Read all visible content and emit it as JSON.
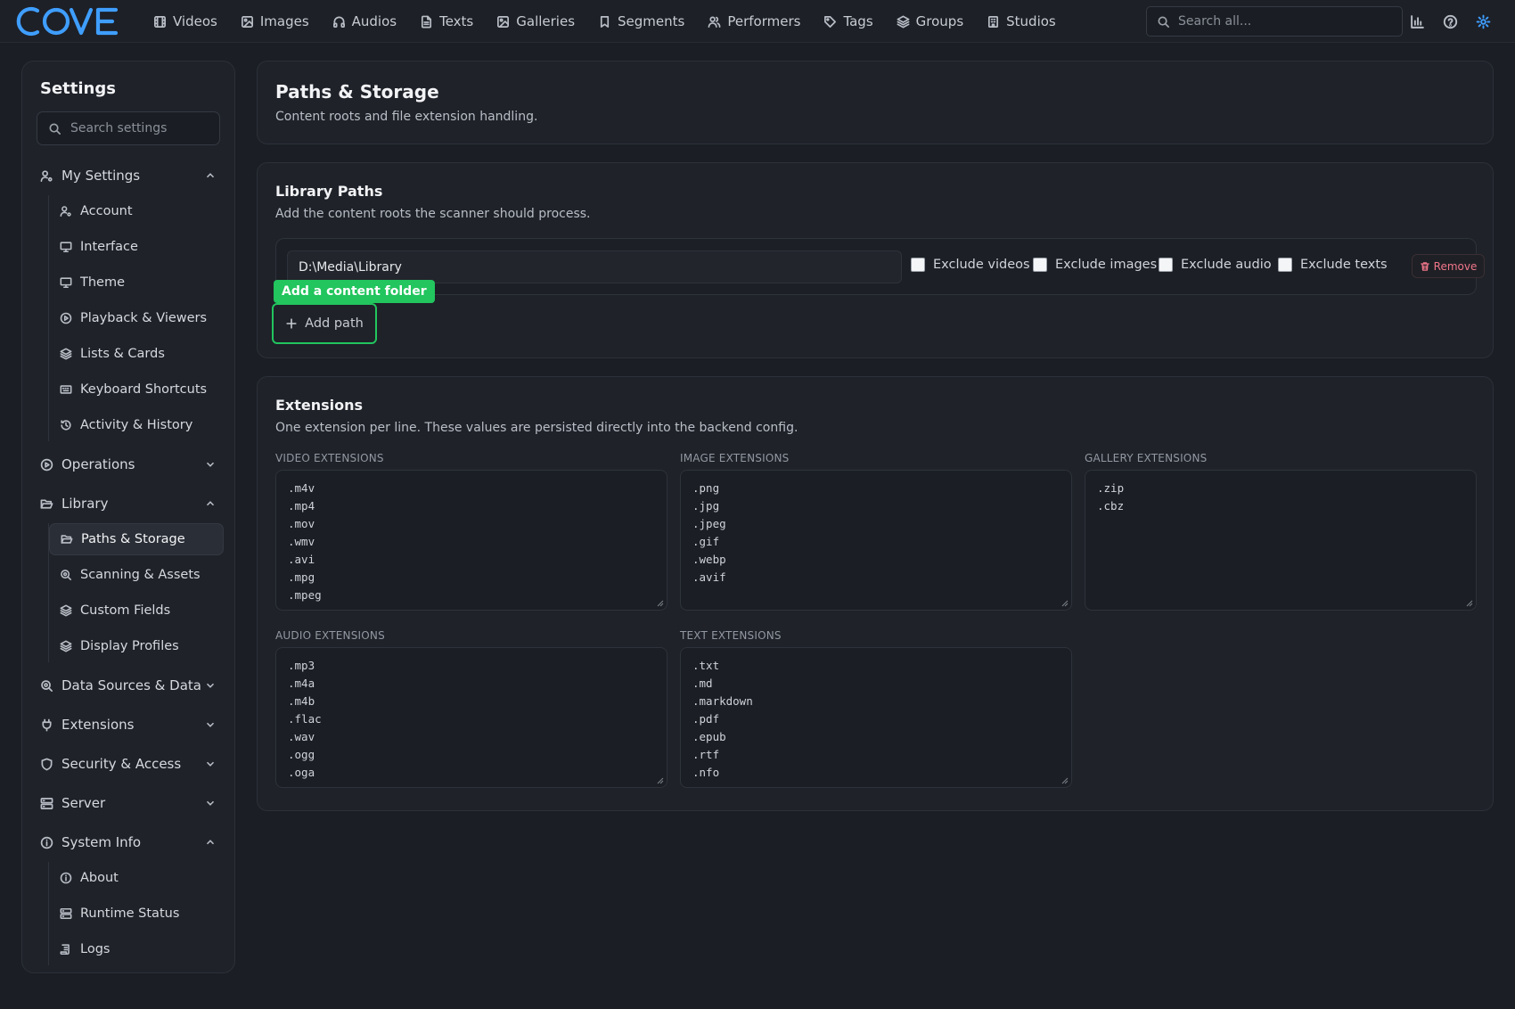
{
  "app": {
    "logo_text": "COVE"
  },
  "nav": [
    {
      "label": "Videos",
      "icon": "film-icon"
    },
    {
      "label": "Images",
      "icon": "image-icon"
    },
    {
      "label": "Audios",
      "icon": "headphones-icon"
    },
    {
      "label": "Texts",
      "icon": "file-text-icon"
    },
    {
      "label": "Galleries",
      "icon": "gallery-icon"
    },
    {
      "label": "Segments",
      "icon": "bookmark-icon"
    },
    {
      "label": "Performers",
      "icon": "users-icon"
    },
    {
      "label": "Tags",
      "icon": "tag-icon"
    },
    {
      "label": "Groups",
      "icon": "layers-icon"
    },
    {
      "label": "Studios",
      "icon": "building-icon"
    }
  ],
  "search": {
    "placeholder": "Search all..."
  },
  "sidebar": {
    "title": "Settings",
    "search_placeholder": "Search settings",
    "my_settings": "My Settings",
    "my_items": [
      "Account",
      "Interface",
      "Theme",
      "Playback & Viewers",
      "Lists & Cards",
      "Keyboard Shortcuts",
      "Activity & History"
    ],
    "operations": "Operations",
    "library": "Library",
    "library_items": [
      "Paths & Storage",
      "Scanning & Assets",
      "Custom Fields",
      "Display Profiles"
    ],
    "data_sources": "Data Sources & Data",
    "extensions": "Extensions",
    "security": "Security & Access",
    "server": "Server",
    "system_info": "System Info",
    "system_items": [
      "About",
      "Runtime Status",
      "Logs"
    ]
  },
  "header": {
    "title": "Paths & Storage",
    "subtitle": "Content roots and file extension handling."
  },
  "library_paths": {
    "title": "Library Paths",
    "subtitle": "Add the content roots the scanner should process.",
    "path_value": "D:\\Media\\Library",
    "exclude_videos": "Exclude videos",
    "exclude_images": "Exclude images",
    "exclude_audio": "Exclude audio",
    "exclude_texts": "Exclude texts",
    "remove_label": "Remove",
    "tooltip": "Add a content folder",
    "add_label": "Add path"
  },
  "extensions": {
    "title": "Extensions",
    "subtitle": "One extension per line. These values are persisted directly into the backend config.",
    "video_label": "VIDEO EXTENSIONS",
    "video": [
      ".m4v",
      ".mp4",
      ".mov",
      ".wmv",
      ".avi",
      ".mpg",
      ".mpeg"
    ],
    "image_label": "IMAGE EXTENSIONS",
    "image": [
      ".png",
      ".jpg",
      ".jpeg",
      ".gif",
      ".webp",
      ".avif"
    ],
    "gallery_label": "GALLERY EXTENSIONS",
    "gallery": [
      ".zip",
      ".cbz"
    ],
    "audio_label": "AUDIO EXTENSIONS",
    "audio": [
      ".mp3",
      ".m4a",
      ".m4b",
      ".flac",
      ".wav",
      ".ogg",
      ".oga"
    ],
    "text_label": "TEXT EXTENSIONS",
    "text": [
      ".txt",
      ".md",
      ".markdown",
      ".pdf",
      ".epub",
      ".rtf",
      ".nfo"
    ]
  },
  "colors": {
    "accent": "#22c55e",
    "active_icon": "#3f9eff",
    "danger": "#f0768a"
  }
}
